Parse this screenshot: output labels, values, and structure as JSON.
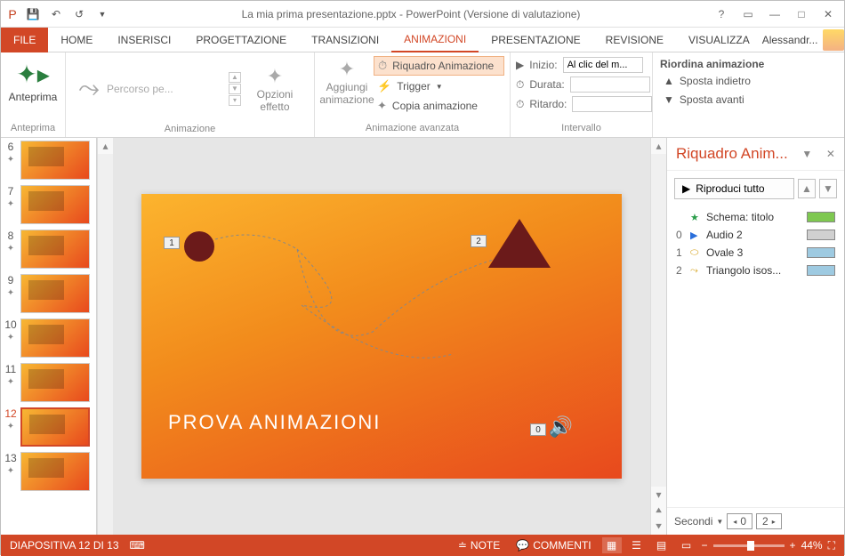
{
  "title": "La mia prima presentazione.pptx - PowerPoint (Versione di valutazione)",
  "tabs": {
    "file": "FILE",
    "home": "HOME",
    "inserisci": "INSERISCI",
    "progettazione": "PROGETTAZIONE",
    "transizioni": "TRANSIZIONI",
    "animazioni": "ANIMAZIONI",
    "presentazione": "PRESENTAZIONE",
    "revisione": "REVISIONE",
    "visualizza": "VISUALIZZA"
  },
  "user": "Alessandr...",
  "ribbon": {
    "anteprima": "Anteprima",
    "anteprima_group": "Anteprima",
    "percorso": "Percorso pe...",
    "animazione_group": "Animazione",
    "opzioni": "Opzioni effetto",
    "aggiungi": "Aggiungi animazione",
    "riquadro": "Riquadro Animazione",
    "trigger": "Trigger",
    "copia": "Copia animazione",
    "avanzata_group": "Animazione avanzata",
    "inizio": "Inizio:",
    "inizio_val": "Al clic del m...",
    "durata": "Durata:",
    "ritardo": "Ritardo:",
    "intervallo_group": "Intervallo",
    "riordina": "Riordina animazione",
    "sposta_ind": "Sposta indietro",
    "sposta_av": "Sposta avanti"
  },
  "thumbs": [
    {
      "n": "6"
    },
    {
      "n": "7"
    },
    {
      "n": "8"
    },
    {
      "n": "9"
    },
    {
      "n": "10"
    },
    {
      "n": "11"
    },
    {
      "n": "12",
      "sel": true
    },
    {
      "n": "13"
    }
  ],
  "slide": {
    "title": "PROVA ANIMAZIONI",
    "markers": {
      "m1": "1",
      "m2": "2",
      "m0": "0"
    }
  },
  "pane": {
    "title": "Riquadro Anim...",
    "play": "Riproduci tutto",
    "items": [
      {
        "idx": "",
        "icon": "★",
        "color": "#2a9d4a",
        "name": "Schema: titolo",
        "bar": "#7ec850"
      },
      {
        "idx": "0",
        "icon": "▶",
        "color": "#2a6fdb",
        "name": "Audio 2",
        "bar": "#d0d0d0"
      },
      {
        "idx": "1",
        "icon": "⬭",
        "color": "#d4a017",
        "name": "Ovale 3",
        "bar": "#9ecae1"
      },
      {
        "idx": "2",
        "icon": "⤳",
        "color": "#d4a017",
        "name": "Triangolo isos...",
        "bar": "#9ecae1"
      }
    ],
    "foot_label": "Secondi",
    "foot_a": "0",
    "foot_b": "2"
  },
  "status": {
    "slide": "DIAPOSITIVA 12 DI 13",
    "note": "NOTE",
    "commenti": "COMMENTI",
    "zoom": "44%"
  }
}
